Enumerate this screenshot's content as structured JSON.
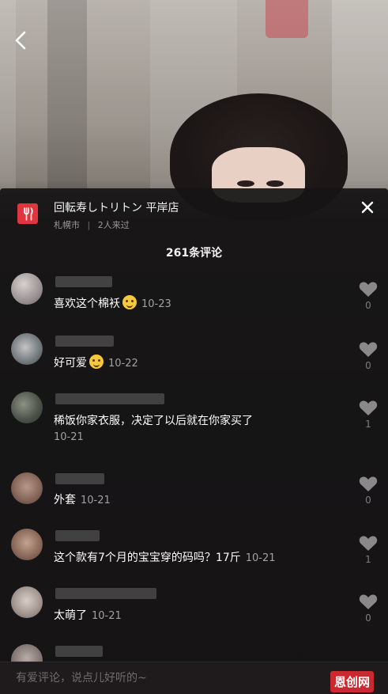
{
  "store": {
    "name": "回転寿しトリトン 平岸店",
    "city": "札幌市",
    "separator": "|",
    "visitors": "2人来过"
  },
  "comment_count_label": "261条评论",
  "comments": [
    {
      "text": "喜欢这个棉袄",
      "emoji": "laughing-emoji",
      "date": "10-23",
      "likes": "0"
    },
    {
      "text": "好可爱",
      "emoji": "smiling-emoji",
      "date": "10-22",
      "likes": "0"
    },
    {
      "text": "稀饭你家衣服，决定了以后就在你家买了",
      "date": "10-21",
      "likes": "1"
    },
    {
      "text": "外套",
      "date": "10-21",
      "likes": "0"
    },
    {
      "text": "这个款有7个月的宝宝穿的码吗？17斤",
      "date": "10-21",
      "likes": "1"
    },
    {
      "text": "太萌了",
      "date": "10-21",
      "likes": "0"
    }
  ],
  "input": {
    "placeholder": "有爱评论，说点儿好听的~"
  },
  "watermark": "恩创网",
  "icons": {
    "back": "back-arrow-icon",
    "close": "close-icon",
    "like": "heart-icon",
    "store": "fork-knife-icon"
  },
  "colors": {
    "accent": "#e0353f",
    "text": "#ffffff",
    "muted": "#a2a0a1"
  }
}
